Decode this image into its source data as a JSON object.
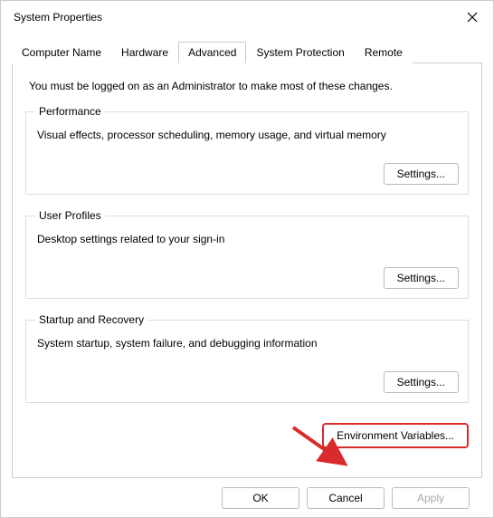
{
  "window": {
    "title": "System Properties"
  },
  "tabs": {
    "items": [
      {
        "label": "Computer Name"
      },
      {
        "label": "Hardware"
      },
      {
        "label": "Advanced"
      },
      {
        "label": "System Protection"
      },
      {
        "label": "Remote"
      }
    ],
    "active_index": 2
  },
  "advanced": {
    "intro": "You must be logged on as an Administrator to make most of these changes.",
    "performance": {
      "legend": "Performance",
      "desc": "Visual effects, processor scheduling, memory usage, and virtual memory",
      "button": "Settings..."
    },
    "userprofiles": {
      "legend": "User Profiles",
      "desc": "Desktop settings related to your sign-in",
      "button": "Settings..."
    },
    "startup": {
      "legend": "Startup and Recovery",
      "desc": "System startup, system failure, and debugging information",
      "button": "Settings..."
    },
    "env_button": "Environment Variables..."
  },
  "footer": {
    "ok": "OK",
    "cancel": "Cancel",
    "apply": "Apply"
  }
}
